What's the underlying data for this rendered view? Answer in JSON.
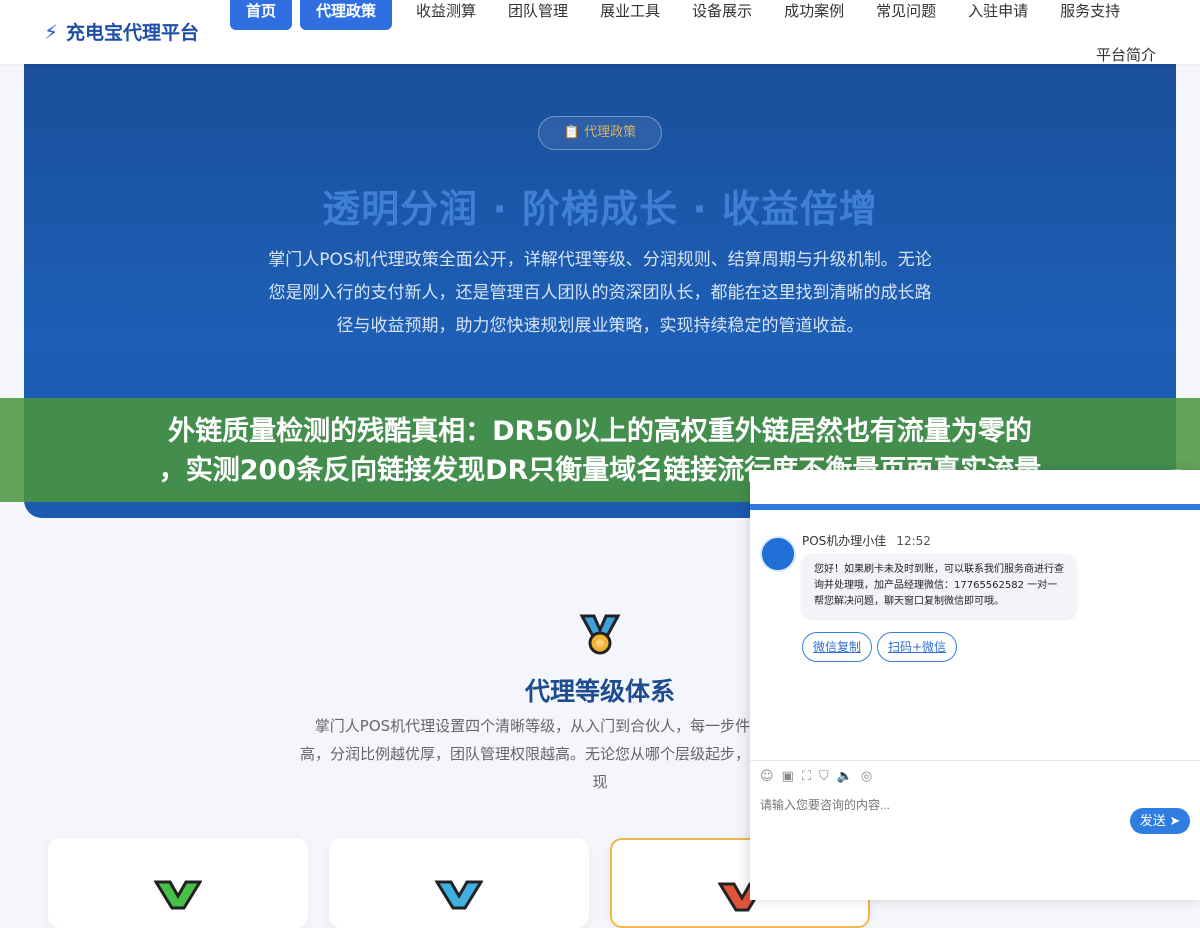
{
  "header": {
    "logo_text": "充电宝代理平台",
    "nav": [
      "首页",
      "代理政策",
      "收益测算",
      "团队管理",
      "展业工具",
      "设备展示",
      "成功案例",
      "常见问题",
      "入驻申请",
      "服务支持"
    ],
    "nav_second_row": "平台简介"
  },
  "hero": {
    "badge": "📋 代理政策",
    "title": "透明分润 · 阶梯成长 · 收益倍增",
    "desc": "掌门人POS机代理政策全面公开，详解代理等级、分润规则、结算周期与升级机制。无论您是刚入行的支付新人，还是管理百人团队的资深团队长，都能在这里找到清晰的成长路径与收益预期，助力您快速规划展业策略，实现持续稳定的管道收益。"
  },
  "banner": {
    "line1": "外链质量检测的残酷真相：DR50以上的高权重外链居然也有流量为零的",
    "line2": "，实测200条反向链接发现DR只衡量域名链接流行度不衡量页面真实流量"
  },
  "section": {
    "title": "代理等级体系",
    "desc": "掌门人POS机代理设置四个清晰等级，从入门到合伙人，每一步件和权益提升。等级越高，分润比例越优厚，团队管理权限越高。无论您从哪个层级起步，都可以通过持续展业实现"
  },
  "chat": {
    "agent_name": "POS机办理小佳",
    "time": "12:52",
    "message": "您好！如果刷卡未及时到账，可以联系我们服务商进行查询并处理哦，加产品经理微信：17765562582 一对一帮您解决问题，聊天窗口复制微信即可哦。",
    "quick_buttons": [
      "微信复制",
      "扫码+微信"
    ],
    "input_placeholder": "请输入您要咨询的内容...",
    "send_label": "发送"
  }
}
